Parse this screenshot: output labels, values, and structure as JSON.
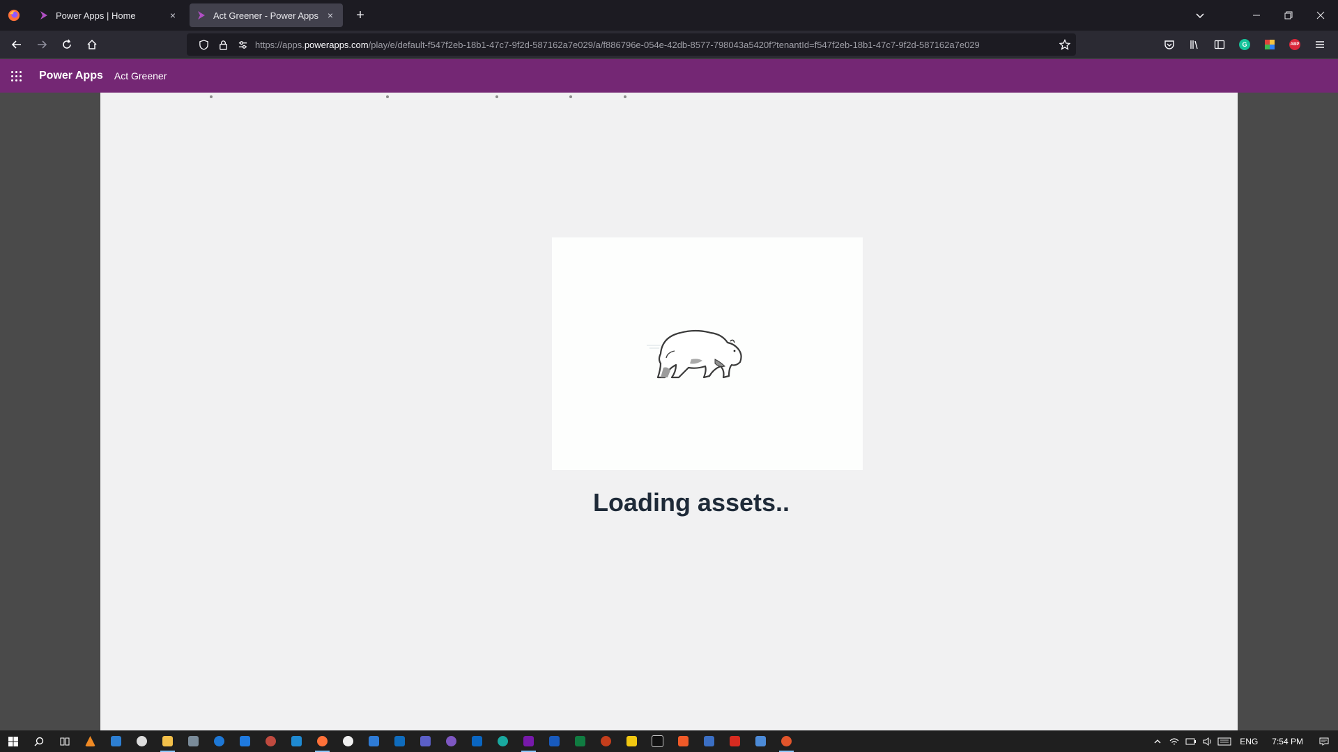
{
  "browser": {
    "tabs": [
      {
        "title": "Power Apps | Home",
        "active": false
      },
      {
        "title": "Act Greener - Power Apps",
        "active": true
      }
    ],
    "new_tab_symbol": "+",
    "close_symbol": "×",
    "url_scheme": "https://apps.",
    "url_host": "powerapps.com",
    "url_path": "/play/e/default-f547f2eb-18b1-47c7-9f2d-587162a7e029/a/f886796e-054e-42db-8577-798043a5420f?tenantId=f547f2eb-18b1-47c7-9f2d-587162a7e029"
  },
  "app_header": {
    "brand": "Power Apps",
    "app_name": "Act Greener"
  },
  "content": {
    "loading_text": "Loading assets..",
    "image": "polar-bear-sketch"
  },
  "taskbar": {
    "language": "ENG",
    "time": "7:54 PM"
  },
  "colors": {
    "header_purple": "#742774",
    "tab_strip": "#1c1b22",
    "toolbar": "#2b2a33",
    "canvas": "#f1f1f2"
  }
}
